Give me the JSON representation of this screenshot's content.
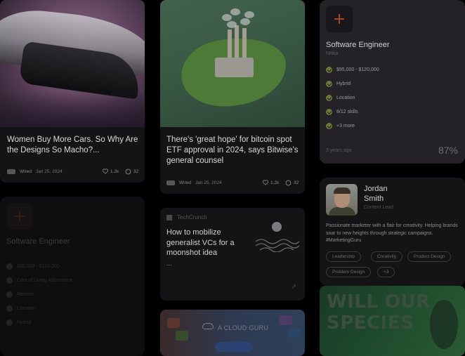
{
  "articles": [
    {
      "title": "Women Buy More Cars. So Why Are the Designs So Macho?...",
      "source": "Wired",
      "date": "Jan 25, 2024",
      "likes": "1.2k",
      "comments": "32"
    },
    {
      "title": "There's 'great hope' for bitcoin spot ETF approval in 2024, says Bitwise's general counsel",
      "source": "Wired",
      "date": "Jan 25, 2024",
      "likes": "1.2k",
      "comments": "32"
    }
  ],
  "jobs": [
    {
      "title": "Software Engineer",
      "company": "Nitika",
      "features": [
        "$95,000 - $120,000",
        "Hybrid",
        "Location",
        "8/12 skills",
        "+3 more"
      ],
      "posted": "3 years ago",
      "match": "87%"
    },
    {
      "title": "Software Engineer",
      "features": [
        "$95,000 - $120,000",
        "Cost of Living Adjustment",
        "Remote",
        "Location",
        "Hybrid"
      ]
    }
  ],
  "idea": {
    "source": "TechCrunch",
    "title": "How to mobilize generalist VCs for a moonshot idea",
    "ellipsis": "...",
    "arrow": "↗"
  },
  "profile": {
    "name": "Jordan Smith",
    "role": "Content Lead",
    "bio": "Passionate marketer with a flair for creativity. Helping brands soar to new heights through strategic campaigns. #MarketingGuru",
    "tags": [
      "Leadership",
      "Creativity",
      "Product Design",
      "Problem Design",
      "+3"
    ]
  },
  "promos": {
    "cloud_title": "A CLOUD GURU",
    "species_line1": "WILL OUR",
    "species_line2": "SPECIES"
  },
  "colors": {
    "accent_orange": "#a2462a",
    "check_green": "#6c7a3a",
    "page_bg": "#000000"
  }
}
